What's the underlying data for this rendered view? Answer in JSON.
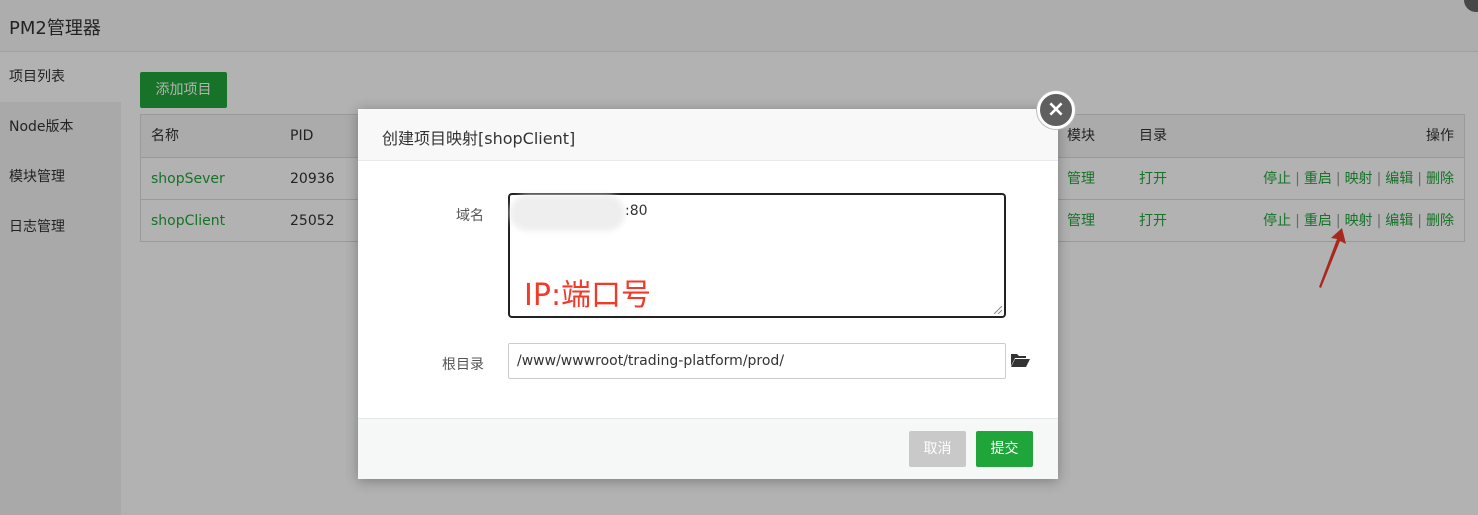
{
  "app": {
    "title": "PM2管理器"
  },
  "sidebar": {
    "items": [
      {
        "label": "项目列表",
        "active": true
      },
      {
        "label": "Node版本"
      },
      {
        "label": "模块管理"
      },
      {
        "label": "日志管理"
      }
    ]
  },
  "toolbar": {
    "add_label": "添加项目"
  },
  "table": {
    "headers": {
      "name": "名称",
      "pid": "PID",
      "module": "模块",
      "dir": "目录",
      "ops": "操作"
    },
    "rows": [
      {
        "name": "shopSever",
        "pid": "20936",
        "module": "管理",
        "dir": "打开"
      },
      {
        "name": "shopClient",
        "pid": "25052",
        "module": "管理",
        "dir": "打开"
      }
    ],
    "actions": {
      "stop": "停止",
      "restart": "重启",
      "map": "映射",
      "edit": "编辑",
      "delete": "删除",
      "sep": "|"
    }
  },
  "modal": {
    "title": "创建项目映射[shopClient]",
    "close_icon": "×",
    "domain_label": "域名",
    "domain_value": ":80",
    "annotation": "IP:端口号",
    "root_label": "根目录",
    "root_value": "/www/wwwroot/trading-platform/prod/",
    "cancel_label": "取消",
    "submit_label": "提交"
  },
  "colors": {
    "accent": "#20a53a",
    "annotation": "#f23a2a"
  }
}
